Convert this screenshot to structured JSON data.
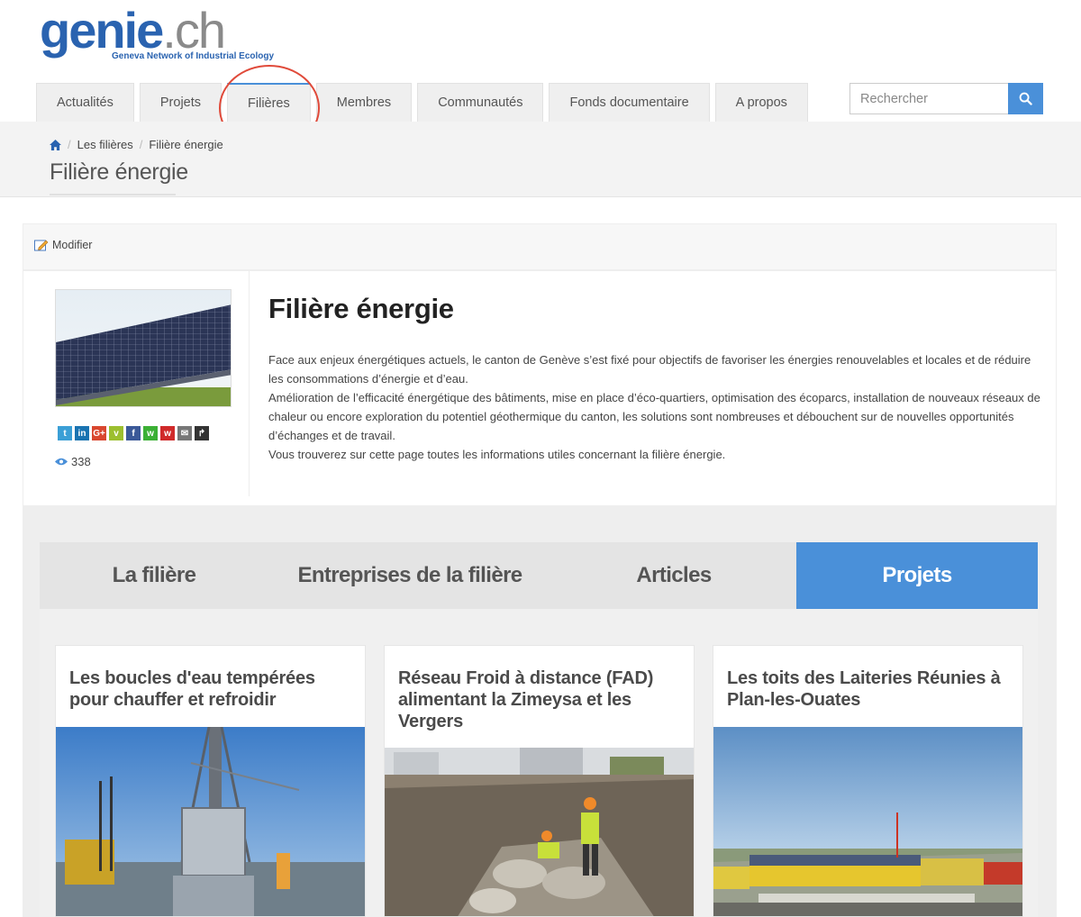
{
  "header": {
    "logo": {
      "main_prefix": "genie",
      "main_suffix": ".ch",
      "tagline": "Geneva Network of Industrial Ecology"
    },
    "nav": [
      {
        "label": "Actualités"
      },
      {
        "label": "Projets"
      },
      {
        "label": "Filières",
        "active": true
      },
      {
        "label": "Membres"
      },
      {
        "label": "Communautés"
      },
      {
        "label": "Fonds documentaire"
      },
      {
        "label": "A propos"
      }
    ],
    "search": {
      "placeholder": "Rechercher",
      "icon": "search-icon"
    }
  },
  "breadcrumb": {
    "home_icon": "home-icon",
    "items": [
      "Les filières",
      "Filière énergie"
    ]
  },
  "page_title": "Filière énergie",
  "edit": {
    "label": "Modifier",
    "icon": "edit-icon"
  },
  "info": {
    "title": "Filière énergie",
    "paragraphs": [
      "Face aux enjeux énergétiques actuels, le canton de Genève s’est fixé pour objectifs de favoriser les énergies renouvelables et locales et de réduire les consommations d’énergie et d’eau.",
      "Amélioration de l’efficacité énergétique des bâtiments, mise en place d’éco-quartiers, optimisation des écoparcs, installation de nouveaux réseaux de chaleur ou encore exploration du potentiel géothermique du canton, les solutions sont nombreuses et débouchent sur de nouvelles opportunités d’échanges et de travail.",
      "Vous trouverez sur cette page toutes les informations utiles concernant la filière énergie."
    ],
    "views": "338",
    "share": [
      {
        "name": "twitter-icon",
        "glyph": "t",
        "color": "#3b9fd6"
      },
      {
        "name": "linkedin-icon",
        "glyph": "in",
        "color": "#1a73b1"
      },
      {
        "name": "googleplus-icon",
        "glyph": "G+",
        "color": "#d9472f"
      },
      {
        "name": "viadeo-icon",
        "glyph": "v",
        "color": "#9cbf2f"
      },
      {
        "name": "facebook-icon",
        "glyph": "f",
        "color": "#3b5998"
      },
      {
        "name": "wechat-icon",
        "glyph": "w",
        "color": "#3cb035"
      },
      {
        "name": "weibo-icon",
        "glyph": "w",
        "color": "#d02a2a"
      },
      {
        "name": "email-icon",
        "glyph": "✉",
        "color": "#777777"
      },
      {
        "name": "share-icon",
        "glyph": "↱",
        "color": "#333333"
      }
    ]
  },
  "tabs": [
    {
      "label": "La filière"
    },
    {
      "label": "Entreprises de la filière"
    },
    {
      "label": "Articles"
    },
    {
      "label": "Projets",
      "active": true
    }
  ],
  "cards": [
    {
      "title": "Les boucles d'eau tempérées pour chauffer et refroidir"
    },
    {
      "title": "Réseau Froid à distance (FAD) alimentant la Zimeysa et les Vergers"
    },
    {
      "title": "Les toits des Laiteries Réunies à Plan-les-Ouates"
    }
  ],
  "colors": {
    "accent": "#4a90d9",
    "brand_blue": "#2a63b0",
    "annotation": "#e04a3a"
  }
}
